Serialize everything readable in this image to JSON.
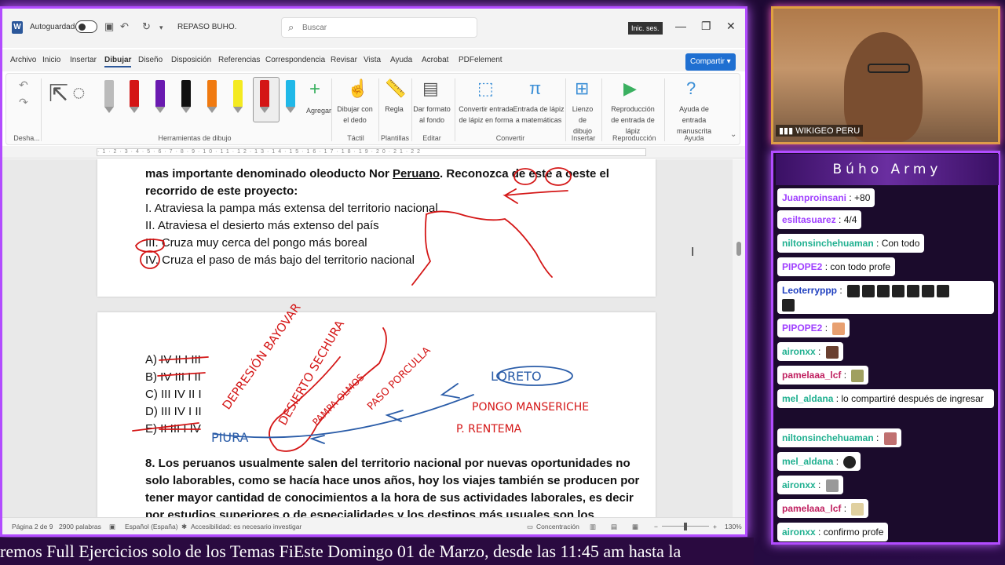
{
  "word": {
    "autosave_label": "Autoguardado",
    "doc_title": "REPASO BUHO.",
    "search_placeholder": "Buscar",
    "signin_label": "Inic. ses.",
    "share_label": "Compartir",
    "menu": [
      "Archivo",
      "Inicio",
      "Insertar",
      "Dibujar",
      "Diseño",
      "Disposición",
      "Referencias",
      "Correspondencia",
      "Revisar",
      "Vista",
      "Ayuda",
      "Acrobat",
      "PDFelement"
    ],
    "ribbon": {
      "undo_group": "Desha...",
      "drawing_tools": "Herramientas de dibujo",
      "add_label": "Agregar",
      "draw_finger": "Dibujar con el dedo",
      "ruler": "Regla",
      "format_bg": "Dar formato al fondo",
      "ink_to_shape": "Convertir entrada de lápiz en forma",
      "ink_to_math": "Entrada de lápiz a matemáticas",
      "canvas": "Lienzo de dibujo",
      "replay": "Reproducción de entrada de lápiz",
      "ink_help": "Ayuda de entrada manuscrita",
      "grp_tactil": "Táctil",
      "grp_plantillas": "Plantillas",
      "grp_editar": "Editar",
      "grp_convertir": "Convertir",
      "grp_insertar": "Insertar",
      "grp_reproduccion": "Reproducción",
      "grp_ayuda": "Ayuda"
    },
    "page1": {
      "line1a": "mas importante denominado oleoducto Nor ",
      "line1b": "Peruano",
      "line1c": ". Reconozca de este a oeste el",
      "line2": "recorrido de este proyecto:",
      "opt1": "I. Atraviesa la pampa más extensa del territorio nacional",
      "opt2": "II. Atraviesa el desierto más extenso del país",
      "opt3": "III. Cruza muy cerca del pongo más boreal",
      "opt4": "IV. Cruza el paso de más bajo del territorio nacional"
    },
    "page2": {
      "answers": [
        "A) IV II I III",
        "B) IV III I II",
        "C) III IV II I",
        "D) III IV I II",
        "E) II III I IV"
      ],
      "q8_lines": [
        "8. Los peruanos usualmente salen del territorio nacional por nuevas oportunidades no",
        "solo laborables, como se hacía hace unos años, hoy los viajes también se producen por",
        "tener mayor cantidad de conocimientos a la hora de sus actividades laborales, es decir",
        "por estudios superiores o de especialidades y los destinos más usuales son los"
      ],
      "ink": {
        "depresion": "DEPRESIÓN BAYOVAR",
        "desierto": "DESIERTO SECHURA",
        "pampa": "PAMPA OLMOS",
        "paso": "PASO PORCULLA",
        "loreto": "LORETO",
        "pongo": "PONGO MANSERICHE",
        "rentema": "P. RENTEMA",
        "piura": "PIURA"
      }
    },
    "status": {
      "page": "Página 2 de 9",
      "words": "2900 palabras",
      "language": "Español (España)",
      "accessibility": "Accesibilidad: es necesario investigar",
      "focus": "Concentración",
      "zoom": "130%"
    }
  },
  "stream": {
    "cam_label": "WIKIGEO PERU",
    "chat_title": "Búho Army",
    "messages": [
      {
        "user": "Juanproinsani",
        "text": "+80",
        "color": "#a040ff"
      },
      {
        "user": "esiltasuarez",
        "text": "4/4",
        "color": "#a040ff"
      },
      {
        "user": "niltonsinchehuaman",
        "text": "Con todo",
        "color": "#20b090"
      },
      {
        "user": "PIPOPE2",
        "text": "con todo profe",
        "color": "#a040ff"
      },
      {
        "user": "Leoterryppp",
        "text": "",
        "color": "#2040c0"
      },
      {
        "user": "PIPOPE2",
        "text": "",
        "color": "#a040ff"
      },
      {
        "user": "aironxx",
        "text": "",
        "color": "#20b090"
      },
      {
        "user": "pamelaaa_lcf",
        "text": "",
        "color": "#c02060"
      },
      {
        "user": "mel_aldana",
        "text": "lo compartiré después de ingresar",
        "color": "#20b090"
      },
      {
        "user": "niltonsinchehuaman",
        "text": "",
        "color": "#20b090"
      },
      {
        "user": "mel_aldana",
        "text": "",
        "color": "#20b090"
      },
      {
        "user": "aironxx",
        "text": "",
        "color": "#20b090"
      },
      {
        "user": "pamelaaa_lcf",
        "text": "",
        "color": "#c02060"
      },
      {
        "user": "aironxx",
        "text": "confirmo profe",
        "color": "#20b090"
      }
    ],
    "ticker": "remos Full Ejercicios solo de los Temas FiEste Domingo 01 de Marzo, desde las 11:45 am hasta la"
  }
}
